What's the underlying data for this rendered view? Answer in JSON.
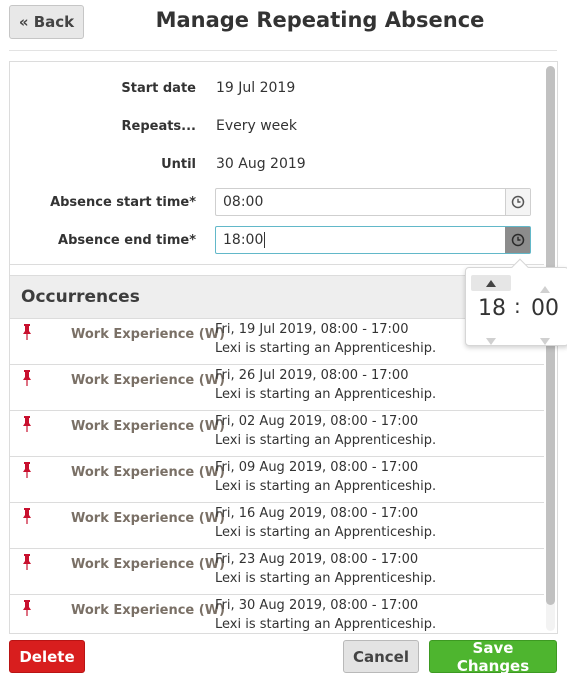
{
  "header": {
    "back_label": "« Back",
    "title": "Manage Repeating Absence"
  },
  "form": {
    "start_date_label": "Start date",
    "start_date_value": "19 Jul 2019",
    "repeats_label": "Repeats...",
    "repeats_value": "Every week",
    "until_label": "Until",
    "until_value": "30 Aug 2019",
    "absence_start_label": "Absence start time*",
    "absence_start_value": "08:00",
    "absence_end_label": "Absence end time*",
    "absence_end_value": "18:00"
  },
  "timepicker": {
    "hour": "18",
    "separator": ":",
    "minute": "00"
  },
  "occurrences": {
    "title": "Occurrences",
    "items": [
      {
        "type": "Work Experience (W)",
        "date": "Fri, 19 Jul 2019, 08:00 - 17:00",
        "note": "Lexi is starting an Apprenticeship."
      },
      {
        "type": "Work Experience (W)",
        "date": "Fri, 26 Jul 2019, 08:00 - 17:00",
        "note": "Lexi is starting an Apprenticeship."
      },
      {
        "type": "Work Experience (W)",
        "date": "Fri, 02 Aug 2019, 08:00 - 17:00",
        "note": "Lexi is starting an Apprenticeship."
      },
      {
        "type": "Work Experience (W)",
        "date": "Fri, 09 Aug 2019, 08:00 - 17:00",
        "note": "Lexi is starting an Apprenticeship."
      },
      {
        "type": "Work Experience (W)",
        "date": "Fri, 16 Aug 2019, 08:00 - 17:00",
        "note": "Lexi is starting an Apprenticeship."
      },
      {
        "type": "Work Experience (W)",
        "date": "Fri, 23 Aug 2019, 08:00 - 17:00",
        "note": "Lexi is starting an Apprenticeship."
      },
      {
        "type": "Work Experience (W)",
        "date": "Fri, 30 Aug 2019, 08:00 - 17:00",
        "note": "Lexi is starting an Apprenticeship."
      }
    ]
  },
  "footer": {
    "delete_label": "Delete",
    "cancel_label": "Cancel",
    "save_label": "Save Changes"
  },
  "colors": {
    "delete": "#d81e1e",
    "save": "#4eb52f",
    "pin": "#c8102e",
    "focus": "#62b8c9"
  },
  "icons": {
    "occurrence": "pushpin-icon",
    "time_addon": "clock-icon"
  }
}
